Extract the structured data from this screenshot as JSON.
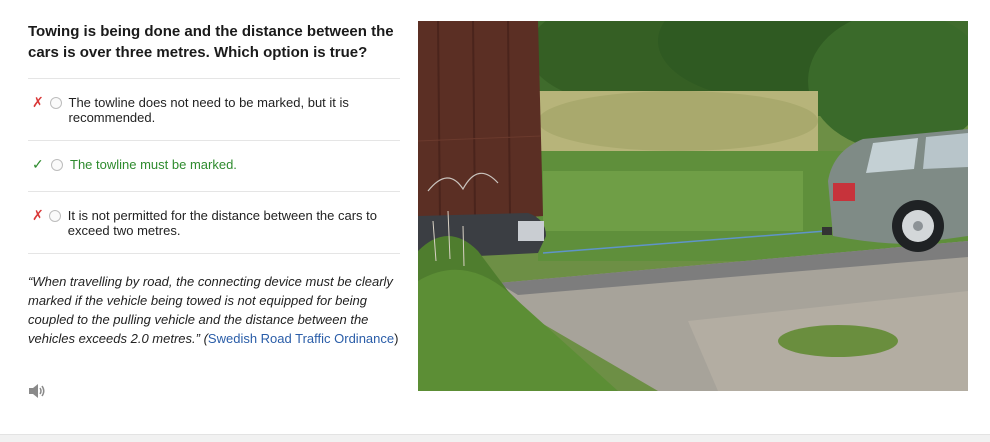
{
  "question": "Towing is being done and the distance between the cars is over three metres. Which option is true?",
  "options": [
    {
      "mark": "✗",
      "status": "wrong",
      "text": "The towline does not need to be marked, but it is recommended."
    },
    {
      "mark": "✓",
      "status": "correct",
      "text": "The towline must be marked."
    },
    {
      "mark": "✗",
      "status": "wrong",
      "text": "It is not permitted for the distance between the cars to exceed two metres."
    }
  ],
  "explanation": {
    "quote_open": "“",
    "quote": "When travelling by road, the connecting device must be clearly marked if the vehicle being towed is not equipped for being coupled to the pulling vehicle and the distance between the vehicles exceeds 2.0 metres.",
    "quote_close": "” (",
    "link": "Swedish Road Traffic Ordinance",
    "close": ")"
  },
  "icons": {
    "audio": "speaker-icon"
  },
  "colors": {
    "wrong": "#d93838",
    "correct": "#2e8b2e",
    "link": "#2a5da8"
  }
}
